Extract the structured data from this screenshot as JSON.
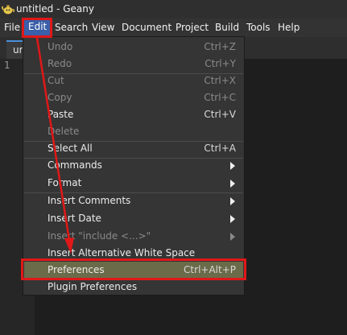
{
  "window": {
    "title": "untitled - Geany",
    "icon": "geany-teapot-icon"
  },
  "menubar": {
    "items": [
      {
        "label": "File"
      },
      {
        "label": "Edit"
      },
      {
        "label": "Search"
      },
      {
        "label": "View"
      },
      {
        "label": "Document"
      },
      {
        "label": "Project"
      },
      {
        "label": "Build"
      },
      {
        "label": "Tools"
      },
      {
        "label": "Help"
      }
    ],
    "active": "Edit"
  },
  "tabs": [
    {
      "label": "untitled"
    }
  ],
  "editor": {
    "line_numbers": [
      "1"
    ]
  },
  "edit_menu": {
    "items": [
      {
        "label": "Undo",
        "accel": "Ctrl+Z",
        "enabled": false
      },
      {
        "label": "Redo",
        "accel": "Ctrl+Y",
        "enabled": false
      },
      {
        "label": "Cut",
        "accel": "Ctrl+X",
        "enabled": false
      },
      {
        "label": "Copy",
        "accel": "Ctrl+C",
        "enabled": false
      },
      {
        "label": "Paste",
        "accel": "Ctrl+V",
        "enabled": true
      },
      {
        "label": "Delete",
        "accel": "",
        "enabled": false
      },
      {
        "label": "Select All",
        "accel": "Ctrl+A",
        "enabled": true
      },
      {
        "label": "Commands",
        "accel": "",
        "enabled": true,
        "submenu": true
      },
      {
        "label": "Format",
        "accel": "",
        "enabled": true,
        "submenu": true
      },
      {
        "label": "Insert Comments",
        "accel": "",
        "enabled": true,
        "submenu": true
      },
      {
        "label": "Insert Date",
        "accel": "",
        "enabled": true,
        "submenu": true
      },
      {
        "label": "Insert \"include <...>\"",
        "accel": "",
        "enabled": false,
        "submenu": true
      },
      {
        "label": "Insert Alternative White Space",
        "accel": "",
        "enabled": true
      },
      {
        "label": "Preferences",
        "accel": "Ctrl+Alt+P",
        "enabled": true,
        "highlighted": true
      },
      {
        "label": "Plugin Preferences",
        "accel": "",
        "enabled": true
      }
    ]
  },
  "colors": {
    "annotation": "#e01818",
    "menu_highlight": "#6b6b4a",
    "menubar_active": "#3b5fa8"
  }
}
